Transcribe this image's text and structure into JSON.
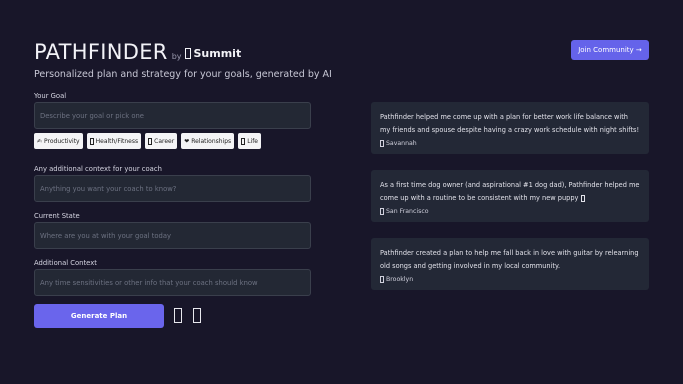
{
  "header": {
    "brand": "PATHFINDER",
    "by": "by",
    "company": "Summit",
    "tagline": "Personalized plan and strategy for your goals, generated by AI"
  },
  "join_button": "Join Community →",
  "form": {
    "goal_label": "Your Goal",
    "goal_placeholder": "Describe your goal or pick one",
    "chips": [
      {
        "icon": "✍",
        "label": "Productivity"
      },
      {
        "icon": "",
        "label": "Health/Fitness"
      },
      {
        "icon": "",
        "label": "Career"
      },
      {
        "icon": "❤",
        "label": "Relationships"
      },
      {
        "icon": "",
        "label": "Life"
      }
    ],
    "context_label": "Any additional context for your coach",
    "context_placeholder": "Anything you want your coach to know?",
    "state_label": "Current State",
    "state_placeholder": "Where are you at with your goal today",
    "additional_label": "Additional Context",
    "additional_placeholder": "Any time sensitivities or other info that your coach should know",
    "generate_label": "Generate Plan"
  },
  "testimonials": [
    {
      "text": "Pathfinder helped me come up with a plan for better work life balance with my friends and spouse despite having a crazy work schedule with night shifts!",
      "author": "Savannah"
    },
    {
      "text": "As a first time dog owner (and aspirational #1 dog dad), Pathfinder helped me come up with a routine to be consistent with my new puppy",
      "author": "San Francisco"
    },
    {
      "text": "Pathfinder created a plan to help me fall back in love with guitar by relearning old songs and getting involved in my local community.",
      "author": "Brooklyn"
    }
  ],
  "colors": {
    "background": "#181629",
    "accent": "#6563ea",
    "card": "#232836"
  }
}
